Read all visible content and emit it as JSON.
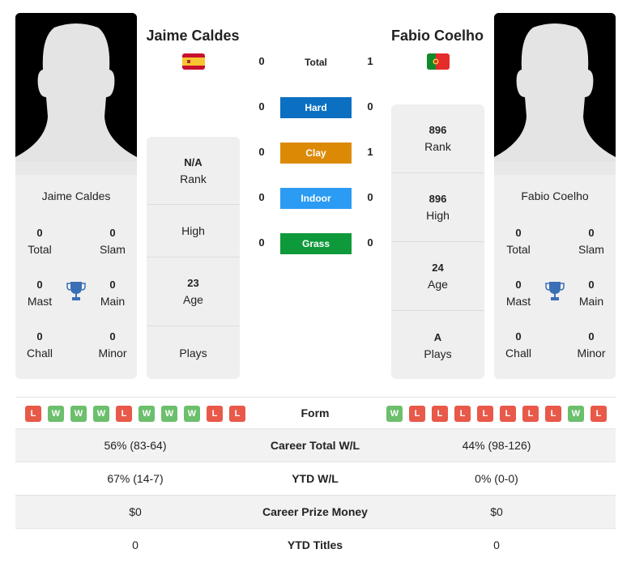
{
  "player1": {
    "name": "Jaime Caldes",
    "country": "Spain",
    "flag_icon": "spain-flag-icon",
    "titles": {
      "total": {
        "value": "0",
        "label": "Total"
      },
      "slam": {
        "value": "0",
        "label": "Slam"
      },
      "mast": {
        "value": "0",
        "label": "Mast"
      },
      "main": {
        "value": "0",
        "label": "Main"
      },
      "chall": {
        "value": "0",
        "label": "Chall"
      },
      "minor": {
        "value": "0",
        "label": "Minor"
      }
    },
    "info": {
      "rank": {
        "value": "N/A",
        "label": "Rank"
      },
      "high": {
        "value": "",
        "label": "High"
      },
      "age": {
        "value": "23",
        "label": "Age"
      },
      "plays": {
        "value": "",
        "label": "Plays"
      }
    },
    "form": [
      "L",
      "W",
      "W",
      "W",
      "L",
      "W",
      "W",
      "W",
      "L",
      "L"
    ]
  },
  "player2": {
    "name": "Fabio Coelho",
    "country": "Portugal",
    "flag_icon": "portugal-flag-icon",
    "titles": {
      "total": {
        "value": "0",
        "label": "Total"
      },
      "slam": {
        "value": "0",
        "label": "Slam"
      },
      "mast": {
        "value": "0",
        "label": "Mast"
      },
      "main": {
        "value": "0",
        "label": "Main"
      },
      "chall": {
        "value": "0",
        "label": "Chall"
      },
      "minor": {
        "value": "0",
        "label": "Minor"
      }
    },
    "info": {
      "rank": {
        "value": "896",
        "label": "Rank"
      },
      "high": {
        "value": "896",
        "label": "High"
      },
      "age": {
        "value": "24",
        "label": "Age"
      },
      "plays": {
        "value": "A",
        "label": "Plays"
      }
    },
    "form": [
      "W",
      "L",
      "L",
      "L",
      "L",
      "L",
      "L",
      "L",
      "W",
      "L"
    ]
  },
  "h2h": [
    {
      "label": "Total",
      "p1": "0",
      "p2": "1",
      "color": ""
    },
    {
      "label": "Hard",
      "p1": "0",
      "p2": "0",
      "color": "#0b6fc2"
    },
    {
      "label": "Clay",
      "p1": "0",
      "p2": "1",
      "color": "#dc8a06"
    },
    {
      "label": "Indoor",
      "p1": "0",
      "p2": "0",
      "color": "#2b9bf3"
    },
    {
      "label": "Grass",
      "p1": "0",
      "p2": "0",
      "color": "#0e9a3a"
    }
  ],
  "form_label": "Form",
  "comparison": [
    {
      "label": "Career Total W/L",
      "p1": "56% (83-64)",
      "p2": "44% (98-126)"
    },
    {
      "label": "YTD W/L",
      "p1": "67% (14-7)",
      "p2": "0% (0-0)"
    },
    {
      "label": "Career Prize Money",
      "p1": "$0",
      "p2": "$0"
    },
    {
      "label": "YTD Titles",
      "p1": "0",
      "p2": "0"
    }
  ],
  "colors": {
    "win": "#6cbf6c",
    "loss": "#e8594a",
    "trophy": "#3a6fb6",
    "card_bg": "#efefef"
  }
}
